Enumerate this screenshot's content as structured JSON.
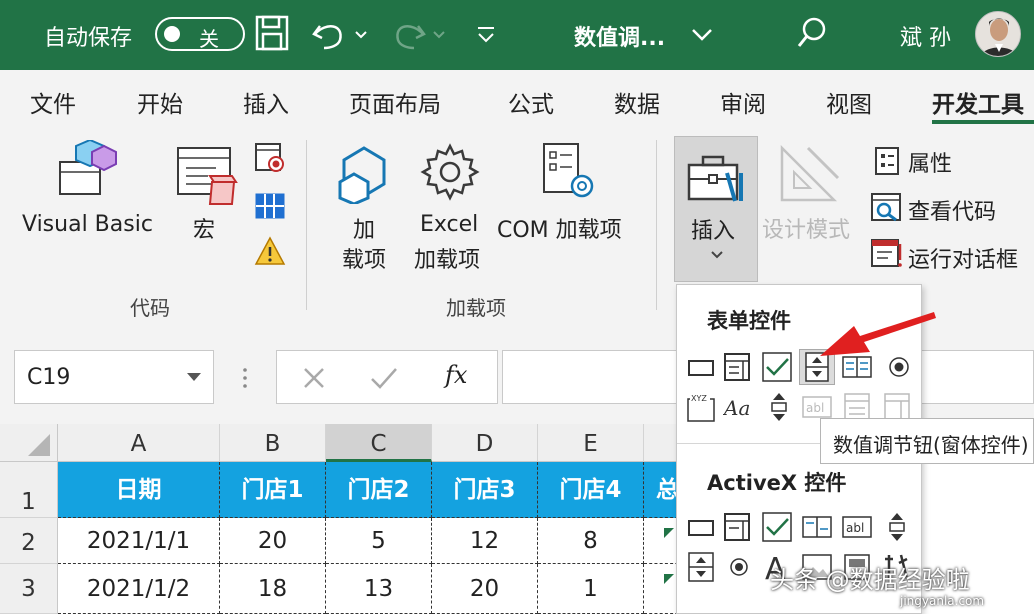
{
  "titlebar": {
    "autosave_label": "自动保存",
    "toggle_state": "关",
    "doc_title": "数值调...",
    "user_name": "斌 孙"
  },
  "tabs": [
    "文件",
    "开始",
    "插入",
    "页面布局",
    "公式",
    "数据",
    "审阅",
    "视图",
    "开发工具"
  ],
  "active_tab": "开发工具",
  "ribbon": {
    "code": {
      "visual_basic": "Visual Basic",
      "macro": "宏",
      "group_label": "代码"
    },
    "addins": {
      "addins_line1": "加",
      "addins_line2": "载项",
      "excel_addins_line1": "Excel",
      "excel_addins_line2": "加载项",
      "com_addins": "COM 加载项",
      "group_label": "加载项"
    },
    "controls": {
      "insert": "插入",
      "design_mode": "设计模式",
      "properties": "属性",
      "view_code": "查看代码",
      "run_dialog": "运行对话框"
    }
  },
  "formula_bar": {
    "name_box": "C19",
    "fx_label": "fx",
    "formula": ""
  },
  "sheet": {
    "columns": [
      "A",
      "B",
      "C",
      "D",
      "E"
    ],
    "selected_column": "C",
    "rows": [
      "1",
      "2",
      "3"
    ],
    "header_row": [
      "日期",
      "门店1",
      "门店2",
      "门店3",
      "门店4",
      "总"
    ],
    "data": [
      [
        "2021/1/1",
        "20",
        "5",
        "12",
        "8"
      ],
      [
        "2021/1/2",
        "18",
        "13",
        "20",
        "1"
      ]
    ]
  },
  "dropdown": {
    "form_controls_title": "表单控件",
    "activex_title": "ActiveX 控件",
    "tooltip": "数值调节钮(窗体控件)",
    "highlighted_control": "spin-button-icon"
  },
  "watermark": {
    "text": "头条 @数据经验啦",
    "sub": "jingyanla.com"
  },
  "colors": {
    "excel_green": "#217346",
    "header_blue": "#14a2e0",
    "arrow_red": "#e02020"
  }
}
